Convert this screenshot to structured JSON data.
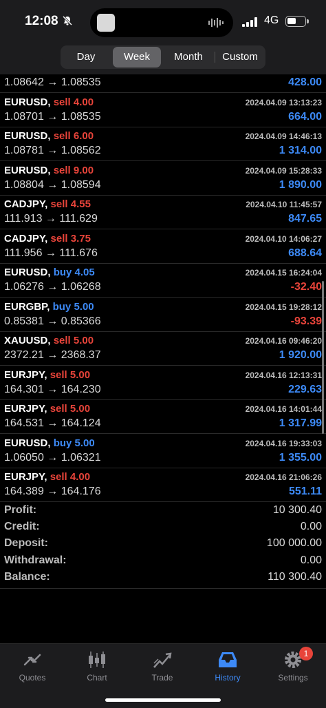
{
  "status_bar": {
    "time": "12:08",
    "network": "4G"
  },
  "period_tabs": [
    {
      "label": "Day",
      "active": false
    },
    {
      "label": "Week",
      "active": true
    },
    {
      "label": "Month",
      "active": false
    },
    {
      "label": "Custom",
      "active": false
    }
  ],
  "deals": [
    {
      "symbol": "",
      "side": "",
      "volume": "",
      "date": "",
      "open": "1.08642",
      "close": "1.08535",
      "profit": "428.00",
      "sign": "pos"
    },
    {
      "symbol": "EURUSD,",
      "side": "sell",
      "volume": "4.00",
      "date": "2024.04.09 13:13:23",
      "open": "1.08701",
      "close": "1.08535",
      "profit": "664.00",
      "sign": "pos"
    },
    {
      "symbol": "EURUSD,",
      "side": "sell",
      "volume": "6.00",
      "date": "2024.04.09 14:46:13",
      "open": "1.08781",
      "close": "1.08562",
      "profit": "1 314.00",
      "sign": "pos"
    },
    {
      "symbol": "EURUSD,",
      "side": "sell",
      "volume": "9.00",
      "date": "2024.04.09 15:28:33",
      "open": "1.08804",
      "close": "1.08594",
      "profit": "1 890.00",
      "sign": "pos"
    },
    {
      "symbol": "CADJPY,",
      "side": "sell",
      "volume": "4.55",
      "date": "2024.04.10 11:45:57",
      "open": "111.913",
      "close": "111.629",
      "profit": "847.65",
      "sign": "pos"
    },
    {
      "symbol": "CADJPY,",
      "side": "sell",
      "volume": "3.75",
      "date": "2024.04.10 14:06:27",
      "open": "111.956",
      "close": "111.676",
      "profit": "688.64",
      "sign": "pos"
    },
    {
      "symbol": "EURUSD,",
      "side": "buy",
      "volume": "4.05",
      "date": "2024.04.15 16:24:04",
      "open": "1.06276",
      "close": "1.06268",
      "profit": "-32.40",
      "sign": "neg"
    },
    {
      "symbol": "EURGBP,",
      "side": "buy",
      "volume": "5.00",
      "date": "2024.04.15 19:28:12",
      "open": "0.85381",
      "close": "0.85366",
      "profit": "-93.39",
      "sign": "neg"
    },
    {
      "symbol": "XAUUSD,",
      "side": "sell",
      "volume": "5.00",
      "date": "2024.04.16 09:46:20",
      "open": "2372.21",
      "close": "2368.37",
      "profit": "1 920.00",
      "sign": "pos"
    },
    {
      "symbol": "EURJPY,",
      "side": "sell",
      "volume": "5.00",
      "date": "2024.04.16 12:13:31",
      "open": "164.301",
      "close": "164.230",
      "profit": "229.63",
      "sign": "pos"
    },
    {
      "symbol": "EURJPY,",
      "side": "sell",
      "volume": "5.00",
      "date": "2024.04.16 14:01:44",
      "open": "164.531",
      "close": "164.124",
      "profit": "1 317.99",
      "sign": "pos"
    },
    {
      "symbol": "EURUSD,",
      "side": "buy",
      "volume": "5.00",
      "date": "2024.04.16 19:33:03",
      "open": "1.06050",
      "close": "1.06321",
      "profit": "1 355.00",
      "sign": "pos"
    },
    {
      "symbol": "EURJPY,",
      "side": "sell",
      "volume": "4.00",
      "date": "2024.04.16 21:06:26",
      "open": "164.389",
      "close": "164.176",
      "profit": "551.11",
      "sign": "pos"
    }
  ],
  "arrow": "→",
  "summary": [
    {
      "label": "Profit:",
      "value": "10 300.40"
    },
    {
      "label": "Credit:",
      "value": "0.00"
    },
    {
      "label": "Deposit:",
      "value": "100 000.00"
    },
    {
      "label": "Withdrawal:",
      "value": "0.00"
    },
    {
      "label": "Balance:",
      "value": "110 300.40"
    }
  ],
  "tabbar": [
    {
      "label": "Quotes",
      "icon": "quotes-icon",
      "active": false
    },
    {
      "label": "Chart",
      "icon": "chart-icon",
      "active": false
    },
    {
      "label": "Trade",
      "icon": "trade-icon",
      "active": false
    },
    {
      "label": "History",
      "icon": "history-icon",
      "active": true
    },
    {
      "label": "Settings",
      "icon": "settings-icon",
      "active": false,
      "badge": "1"
    }
  ],
  "colors": {
    "sell": "#e8443a",
    "buy": "#3d8af7",
    "profit_positive": "#3d8af7",
    "profit_negative": "#e8443a",
    "active_tab": "#3d8af7"
  }
}
